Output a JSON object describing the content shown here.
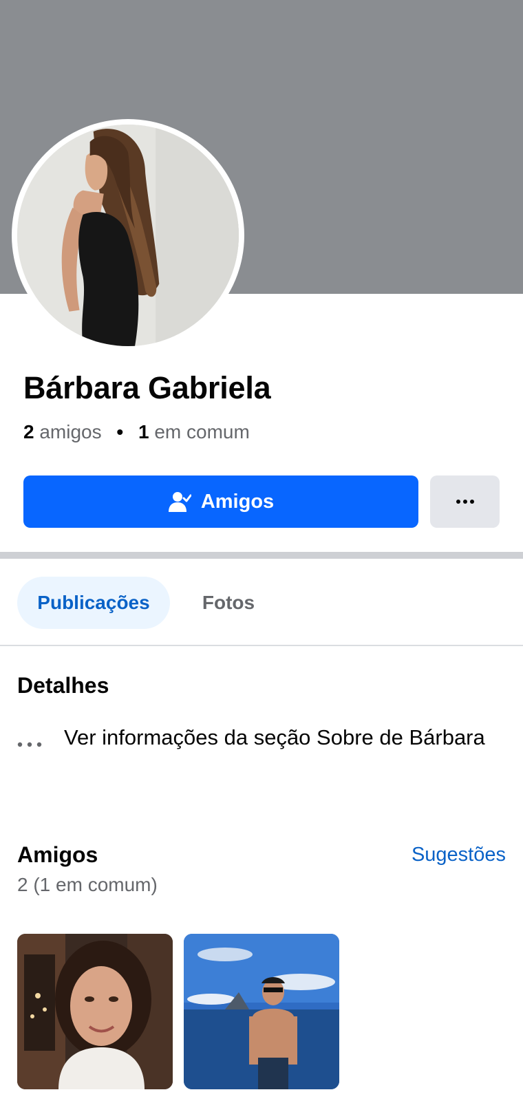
{
  "profile": {
    "name": "Bárbara Gabriela",
    "friends_count": "2",
    "friends_label": "amigos",
    "separator": "•",
    "mutual_count": "1",
    "mutual_label": "em comum",
    "cover_color": "#8a8d91"
  },
  "actions": {
    "primary_label": "Amigos",
    "primary_icon": "friend-check-icon",
    "more_icon": "more-dots-icon",
    "primary_color": "#0866ff"
  },
  "tabs": [
    {
      "label": "Publicações",
      "active": true
    },
    {
      "label": "Fotos",
      "active": false
    }
  ],
  "details": {
    "title": "Detalhes",
    "about_icon": "more-dots-icon",
    "about_text": "Ver informações da seção Sobre de Bárbara"
  },
  "friends": {
    "title": "Amigos",
    "suggestions_label": "Sugestões",
    "count_text": "2 (1 em comum)"
  },
  "colors": {
    "link": "#0a62c7",
    "secondary_text": "#65676b",
    "active_tab_bg": "#ebf5ff"
  }
}
